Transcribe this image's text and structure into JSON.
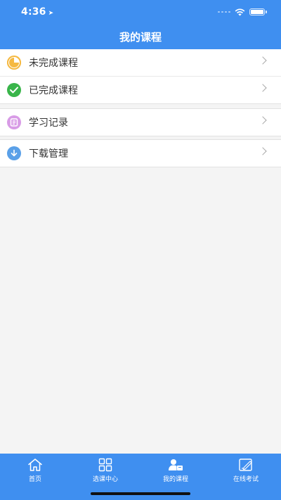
{
  "status_bar": {
    "time": "4:36"
  },
  "nav": {
    "title": "我的课程"
  },
  "groups": {
    "courses": [
      {
        "label": "未完成课程",
        "icon": "pie-chart-icon",
        "icon_color": "#f5b942"
      },
      {
        "label": "已完成课程",
        "icon": "check-circle-icon",
        "icon_color": "#39b54a"
      }
    ],
    "records": {
      "label": "学习记录",
      "icon": "record-book-icon",
      "icon_color": "#d89be6"
    },
    "downloads": {
      "label": "下载管理",
      "icon": "download-icon",
      "icon_color": "#5aa0e8"
    }
  },
  "tabbar": {
    "tabs": [
      {
        "label": "首页",
        "icon": "home-icon"
      },
      {
        "label": "选课中心",
        "icon": "grid-icon"
      },
      {
        "label": "我的课程",
        "icon": "user-course-icon"
      },
      {
        "label": "在线考试",
        "icon": "exam-edit-icon"
      }
    ],
    "active_index": 2
  },
  "colors": {
    "brand_blue": "#3f8ff0",
    "background": "#f4f4f4"
  }
}
